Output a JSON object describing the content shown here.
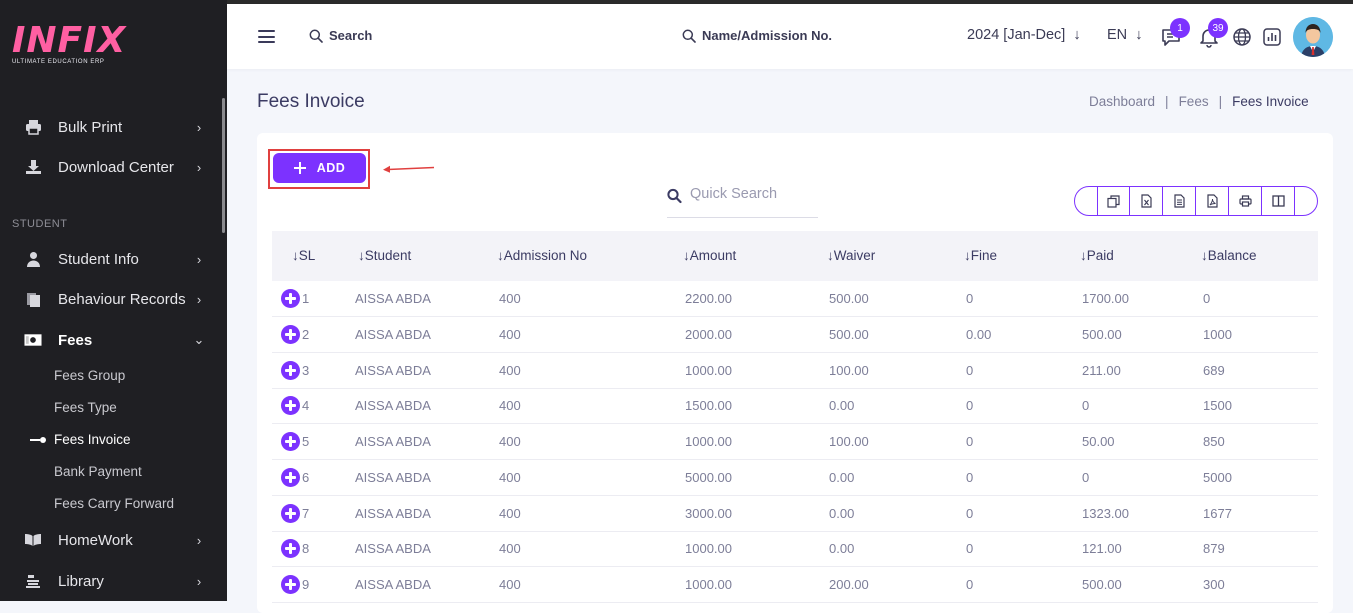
{
  "brand": {
    "logo_text": "INFIX",
    "logo_sub": "ULTIMATE EDUCATION ERP"
  },
  "sidebar": {
    "items_top": [
      {
        "label": "Bulk Print",
        "icon": "printer-icon"
      },
      {
        "label": "Download Center",
        "icon": "download-icon"
      }
    ],
    "section": "STUDENT",
    "items_student": [
      {
        "label": "Student Info",
        "icon": "user-icon"
      },
      {
        "label": "Behaviour Records",
        "icon": "document-icon"
      },
      {
        "label": "Fees",
        "icon": "money-icon"
      }
    ],
    "fees_sub": [
      {
        "label": "Fees Group"
      },
      {
        "label": "Fees Type"
      },
      {
        "label": "Fees Invoice"
      },
      {
        "label": "Bank Payment"
      },
      {
        "label": "Fees Carry Forward"
      }
    ],
    "items_bottom": [
      {
        "label": "HomeWork",
        "icon": "book-icon"
      },
      {
        "label": "Library",
        "icon": "library-icon"
      }
    ]
  },
  "header": {
    "search_label": "Search",
    "search2_label": "Name/Admission No.",
    "year": "2024 [Jan-Dec]",
    "lang": "EN",
    "chat_badge": "1",
    "notif_badge": "39"
  },
  "page": {
    "title": "Fees Invoice",
    "breadcrumb": [
      "Dashboard",
      "Fees",
      "Fees Invoice"
    ]
  },
  "toolbar": {
    "add_label": "ADD",
    "quick_search_placeholder": "Quick Search",
    "export_buttons": [
      "copy-icon",
      "excel-icon",
      "csv-icon",
      "pdf-icon",
      "print-icon",
      "columns-icon"
    ]
  },
  "table": {
    "headers": [
      "SL",
      "Student",
      "Admission No",
      "Amount",
      "Waiver",
      "Fine",
      "Paid",
      "Balance"
    ],
    "rows": [
      [
        "1",
        "AISSA ABDA",
        "400",
        "2200.00",
        "500.00",
        "0",
        "1700.00",
        "0"
      ],
      [
        "2",
        "AISSA ABDA",
        "400",
        "2000.00",
        "500.00",
        "0.00",
        "500.00",
        "1000"
      ],
      [
        "3",
        "AISSA ABDA",
        "400",
        "1000.00",
        "100.00",
        "0",
        "211.00",
        "689"
      ],
      [
        "4",
        "AISSA ABDA",
        "400",
        "1500.00",
        "0.00",
        "0",
        "0",
        "1500"
      ],
      [
        "5",
        "AISSA ABDA",
        "400",
        "1000.00",
        "100.00",
        "0",
        "50.00",
        "850"
      ],
      [
        "6",
        "AISSA ABDA",
        "400",
        "5000.00",
        "0.00",
        "0",
        "0",
        "5000"
      ],
      [
        "7",
        "AISSA ABDA",
        "400",
        "3000.00",
        "0.00",
        "0",
        "1323.00",
        "1677"
      ],
      [
        "8",
        "AISSA ABDA",
        "400",
        "1000.00",
        "0.00",
        "0",
        "121.00",
        "879"
      ],
      [
        "9",
        "AISSA ABDA",
        "400",
        "1000.00",
        "200.00",
        "0",
        "500.00",
        "300"
      ]
    ]
  },
  "colors": {
    "accent": "#7c32ff",
    "sidebar_bg": "#1f1f23",
    "highlight_border": "#e0403f"
  }
}
